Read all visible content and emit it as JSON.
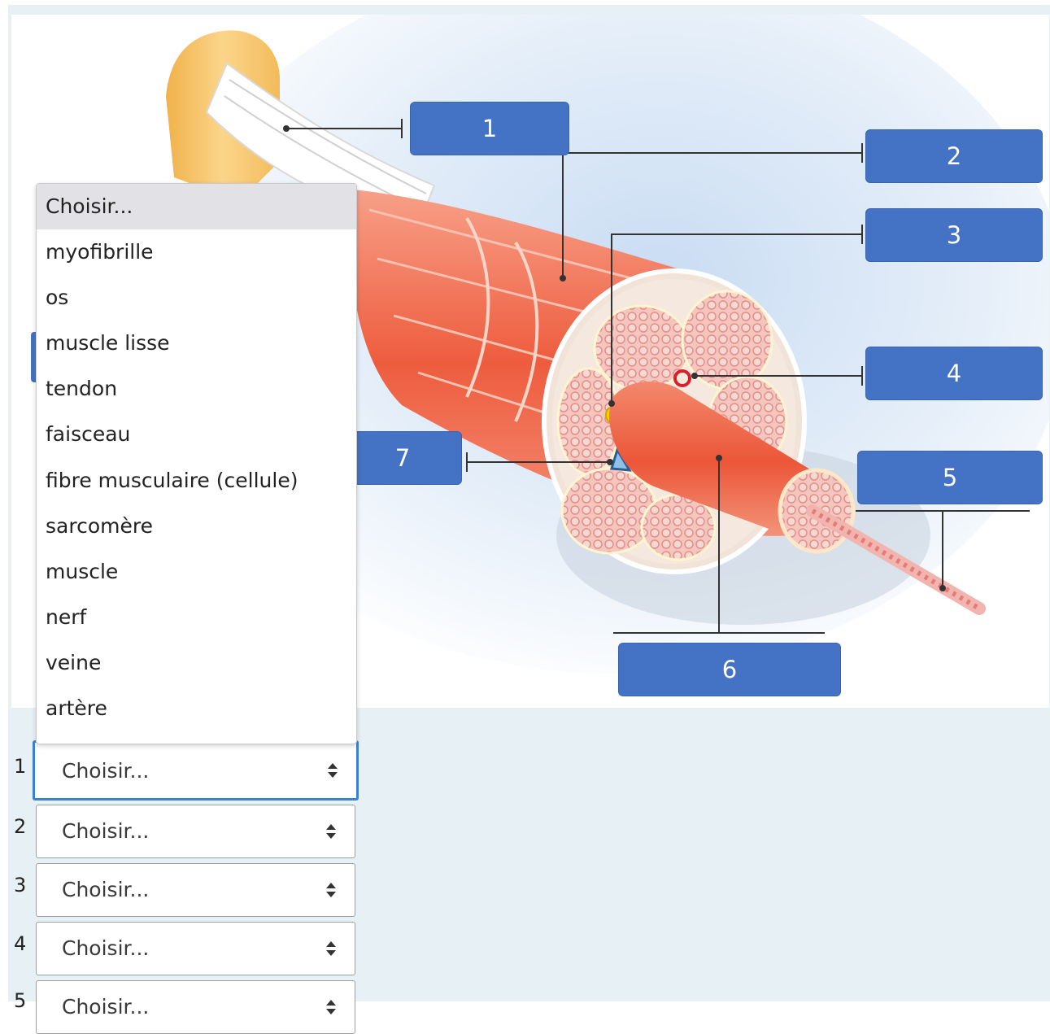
{
  "diagram": {
    "labels": [
      "1",
      "2",
      "3",
      "4",
      "5",
      "6",
      "7"
    ]
  },
  "dropdown": {
    "options": [
      "Choisir...",
      "myofibrille",
      "os",
      "muscle lisse",
      "tendon",
      "faisceau",
      "fibre musculaire (cellule)",
      "sarcomère",
      "muscle",
      "nerf",
      "veine",
      "artère"
    ],
    "selected_index": 0
  },
  "answers": [
    {
      "number": "1",
      "value": "Choisir..."
    },
    {
      "number": "2",
      "value": "Choisir..."
    },
    {
      "number": "3",
      "value": "Choisir..."
    },
    {
      "number": "4",
      "value": "Choisir..."
    },
    {
      "number": "5",
      "value": "Choisir..."
    }
  ],
  "colors": {
    "label_box": "#4472c4",
    "panel_bg": "#e7f1f5",
    "focus_border": "#3a82d6",
    "muscle": "#ef6a4c"
  }
}
